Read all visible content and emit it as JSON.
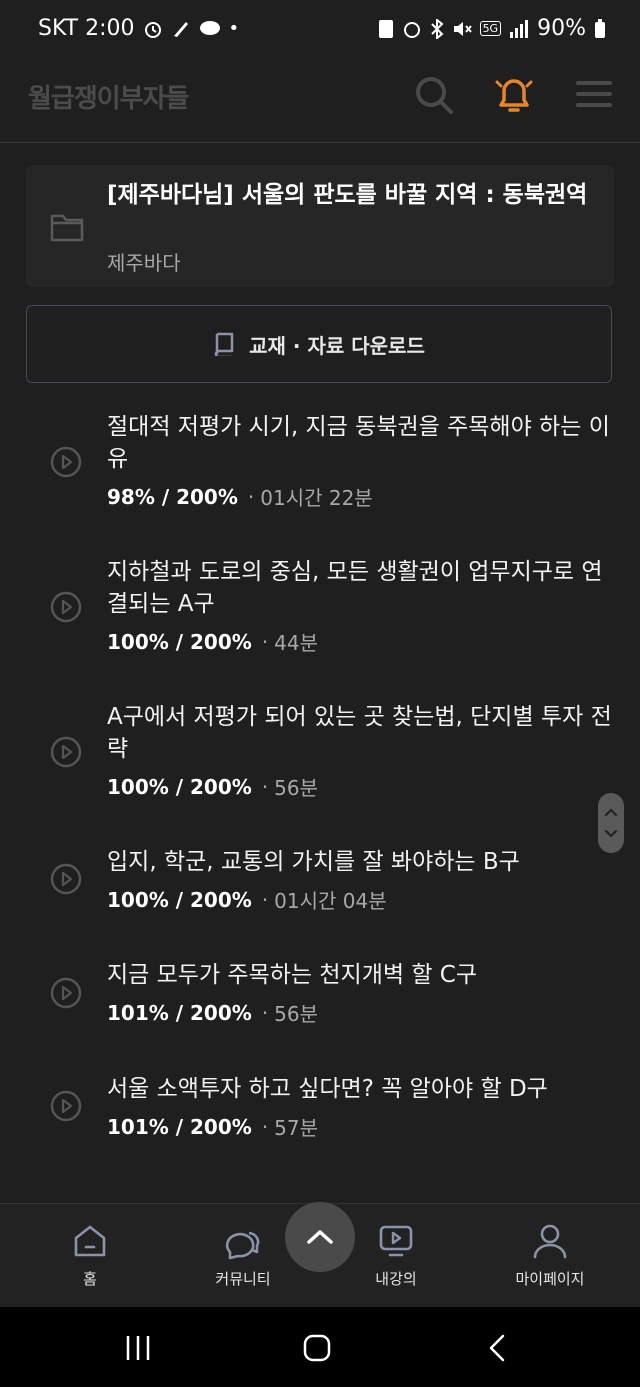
{
  "status_bar": {
    "carrier_time": "SKT 2:00",
    "network": "5G",
    "battery": "90%"
  },
  "header": {
    "logo": "월급쟁이부자들",
    "icons": [
      "search-icon",
      "bell-icon",
      "menu-icon"
    ],
    "accent_color": "#e8862a"
  },
  "course": {
    "title": "[제주바다님] 서울의 판도를 바꿀 지역 : 동북권역",
    "instructor": "제주바다"
  },
  "download": {
    "label": "교재 · 자료 다운로드"
  },
  "lessons": [
    {
      "title": "절대적 저평가 시기, 지금 동북권을 주목해야 하는 이유",
      "progress": "98% / 200%",
      "duration": "01시간 22분"
    },
    {
      "title": "지하철과 도로의 중심, 모든 생활권이 업무지구로 연결되는 A구",
      "progress": "100% / 200%",
      "duration": "44분"
    },
    {
      "title": "A구에서 저평가 되어 있는 곳 찾는법, 단지별 투자 전략",
      "progress": "100% / 200%",
      "duration": "56분"
    },
    {
      "title": "입지, 학군, 교통의 가치를 잘 봐야하는 B구",
      "progress": "100% / 200%",
      "duration": "01시간 04분"
    },
    {
      "title": "지금 모두가 주목하는 천지개벽 할 C구",
      "progress": "101% / 200%",
      "duration": "56분"
    },
    {
      "title": "서울 소액투자 하고 싶다면? 꼭 알아야 할 D구",
      "progress": "101% / 200%",
      "duration": "57분"
    }
  ],
  "bottom_nav": {
    "items": [
      {
        "label": "홈",
        "icon": "home-icon"
      },
      {
        "label": "커뮤니티",
        "icon": "chat-icon"
      },
      {
        "label": "내강의",
        "icon": "play-icon"
      },
      {
        "label": "마이페이지",
        "icon": "user-icon"
      }
    ],
    "scroll_top_icon": "chevron-up-icon"
  }
}
